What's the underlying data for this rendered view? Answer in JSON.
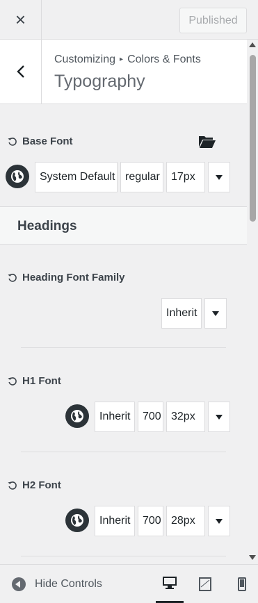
{
  "header": {
    "close_label": "×",
    "publish_label": "Published"
  },
  "section": {
    "breadcrumb_root": "Customizing",
    "breadcrumb_sep": "▸",
    "breadcrumb_parent": "Colors & Fonts",
    "title": "Typography"
  },
  "base_font": {
    "label": "Base Font",
    "family": "System Default",
    "weight": "regular",
    "size": "17px"
  },
  "headings_section": {
    "title": "Headings"
  },
  "heading_family": {
    "label": "Heading Font Family",
    "value": "Inherit"
  },
  "h1": {
    "label": "H1 Font",
    "family": "Inherit",
    "weight": "700",
    "size": "32px"
  },
  "h2": {
    "label": "H2 Font",
    "family": "Inherit",
    "weight": "700",
    "size": "28px"
  },
  "footer": {
    "hide_label": "Hide Controls",
    "devices": [
      "desktop",
      "tablet",
      "mobile"
    ],
    "active_device": "desktop"
  },
  "colors": {
    "accent_dark": "#2c3338",
    "border": "#dcdcde",
    "panel_bg": "#f0f0f1"
  }
}
